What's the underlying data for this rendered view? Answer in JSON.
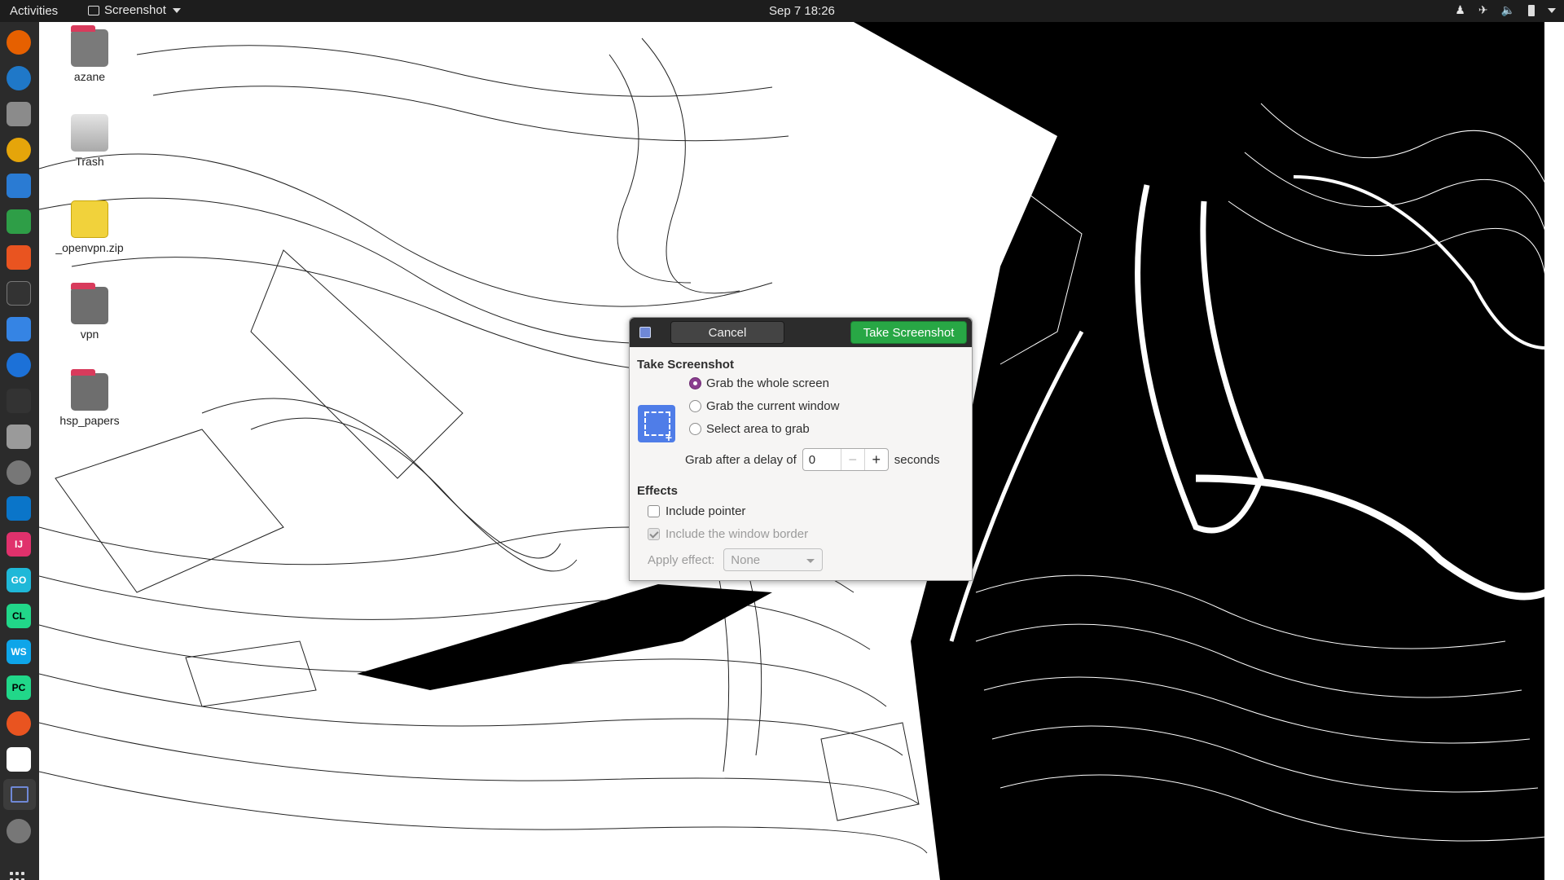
{
  "topbar": {
    "activities": "Activities",
    "app_name": "Screenshot",
    "clock": "Sep 7  18:26",
    "tray_icons": [
      "accessibility-icon",
      "airplane-mode-icon",
      "volume-icon",
      "battery-icon",
      "system-menu-caret-icon"
    ]
  },
  "dock": {
    "apps": [
      "firefox-icon",
      "thunderbird-icon",
      "files-icon",
      "rhythmbox-icon",
      "libreoffice-writer-icon",
      "libreoffice-calc-icon",
      "software-center-icon",
      "terminal-icon",
      "todo-icon",
      "help-icon",
      "system-monitor-icon",
      "search-tool-icon",
      "remote-desktop-icon",
      "vscode-icon",
      "intellij-icon",
      "goland-icon",
      "clion-icon",
      "webstorm-icon",
      "pycharm-icon",
      "update-icon",
      "pitivi-icon",
      "screenshot-icon",
      "settings-icon",
      "show-applications-icon"
    ],
    "labels": {
      "intellij": "IJ",
      "goland": "GO",
      "clion": "CL",
      "webstorm": "WS",
      "pycharm": "PC"
    }
  },
  "desktop": {
    "icons": [
      {
        "label": "azane",
        "type": "home-folder"
      },
      {
        "label": "Trash",
        "type": "trash"
      },
      {
        "label": "_openvpn.zip",
        "type": "zip"
      },
      {
        "label": "vpn",
        "type": "folder"
      },
      {
        "label": "hsp_papers",
        "type": "folder"
      }
    ]
  },
  "dialog": {
    "cancel": "Cancel",
    "take_screenshot_button": "Take Screenshot",
    "section_take": "Take Screenshot",
    "options": [
      {
        "label": "Grab the whole screen",
        "selected": true
      },
      {
        "label": "Grab the current window",
        "selected": false
      },
      {
        "label": "Select area to grab",
        "selected": false
      }
    ],
    "delay_label": "Grab after a delay of",
    "delay_value": "0",
    "delay_unit": "seconds",
    "section_effects": "Effects",
    "include_pointer": "Include pointer",
    "include_border": "Include the window border",
    "apply_effect_label": "Apply effect:",
    "apply_effect_value": "None"
  },
  "colors": {
    "topbar": "#1d1d1d",
    "dock": "#2b2b2b",
    "accent_green": "#28a745",
    "radio_selected": "#8a3d8f",
    "folder_tab": "#d83b5c"
  }
}
